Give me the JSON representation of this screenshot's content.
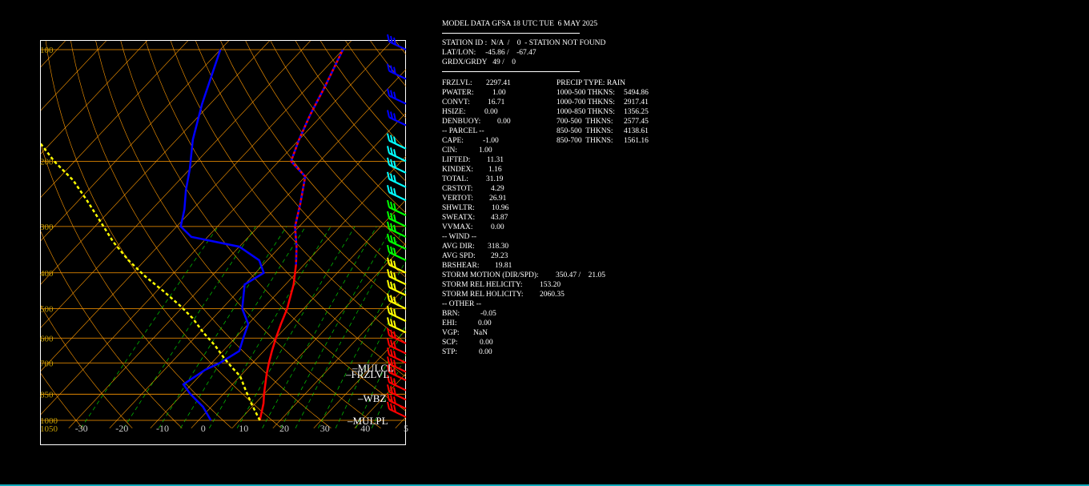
{
  "header": {
    "title": "MODEL DATA GFSA 18 UTC TUE  6 MAY 2025",
    "station": "STATION ID :  N/A  /    0  - STATION NOT FOUND",
    "latlon": "LAT/LON:     -45.86 /    -67.47",
    "grid": "GRDX/GRDY   49 /    0"
  },
  "left_stats": [
    {
      "k": "FRZLVL:",
      "v": "2297.41"
    },
    {
      "k": "PWATER:",
      "v": "1.00"
    },
    {
      "k": "CONVT:",
      "v": "16.71"
    },
    {
      "k": "HSIZE:",
      "v": "0.00"
    },
    {
      "k": "DENBUOY:",
      "v": "0.00"
    },
    {
      "k": "-- PARCEL --",
      "v": ""
    },
    {
      "k": "CAPE:",
      "v": "-1.00"
    },
    {
      "k": "CIN:",
      "v": "1.00"
    },
    {
      "k": "LIFTED:",
      "v": "11.31"
    },
    {
      "k": "KINDEX:",
      "v": "1.16"
    },
    {
      "k": "TOTAL:",
      "v": "31.19"
    },
    {
      "k": "CRSTOT:",
      "v": "4.29"
    },
    {
      "k": "VERTOT:",
      "v": "26.91"
    },
    {
      "k": "SHWLTR:",
      "v": "10.96"
    },
    {
      "k": "SWEATX:",
      "v": "43.87"
    },
    {
      "k": "VVMAX:",
      "v": "0.00"
    },
    {
      "k": "-- WIND --",
      "v": ""
    },
    {
      "k": "AVG DIR:",
      "v": "318.30"
    },
    {
      "k": "AVG SPD:",
      "v": "29.23"
    },
    {
      "k": "BRSHEAR:",
      "v": "19.81"
    },
    {
      "k": "STORM MOTION (DIR/SPD):",
      "v": "350.47 /    21.05"
    },
    {
      "k": "STORM REL HELICITY:",
      "v": "153.20"
    },
    {
      "k": "STORM REL HOLICITY:",
      "v": "2060.35"
    },
    {
      "k": "-- OTHER --",
      "v": ""
    },
    {
      "k": "BRN:",
      "v": "-0.05"
    },
    {
      "k": "EHI:",
      "v": "0.00"
    },
    {
      "k": "VGP:",
      "v": "NaN"
    },
    {
      "k": "SCP:",
      "v": "0.00"
    },
    {
      "k": "STP:",
      "v": "0.00"
    }
  ],
  "right_stats": [
    {
      "k": "PRECIP TYPE: RAIN",
      "v": ""
    },
    {
      "k": "1000-500 THKNS:",
      "v": "5494.86"
    },
    {
      "k": "1000-700 THKNS:",
      "v": "2917.41"
    },
    {
      "k": "1000-850 THKNS:",
      "v": "1356.25"
    },
    {
      "k": "700-500  THKNS:",
      "v": "2577.45"
    },
    {
      "k": "850-500  THKNS:",
      "v": "4138.61"
    },
    {
      "k": "850-700  THKNS:",
      "v": "1561.16"
    }
  ],
  "chart_data": {
    "type": "line",
    "xlabel": "",
    "ylabel": "",
    "x_ticks": [
      "-30",
      "-20",
      "-10",
      "0",
      "10",
      "20",
      "30",
      "40",
      "5"
    ],
    "x_tick_values": [
      -30,
      -20,
      -10,
      0,
      10,
      20,
      30,
      40,
      50
    ],
    "y_ticks": [
      "100",
      "200",
      "300",
      "400",
      "500",
      "600",
      "700",
      "850",
      "1000",
      "1050"
    ],
    "y_tick_values": [
      100,
      200,
      300,
      400,
      500,
      600,
      700,
      850,
      1000,
      1050
    ],
    "xlim": [
      -40,
      50
    ],
    "ylim": [
      1050,
      100
    ],
    "level_labels": [
      {
        "text": "MULCL",
        "p": 700
      },
      {
        "text": "FRZLVL",
        "p": 720
      },
      {
        "text": "WBZ",
        "p": 850
      },
      {
        "text": "MULPL",
        "p": 1000
      }
    ],
    "colors": {
      "temperature": "#ff0000",
      "dewpoint": "#0000ff",
      "parcel": "#ffff00",
      "isotherm": "#ff9900",
      "isobar": "#ff9900",
      "mixing_ratio": "#00cc00"
    },
    "series": [
      {
        "name": "Temperature",
        "color": "#ff0000",
        "points": [
          [
            15,
            1000
          ],
          [
            12,
            900
          ],
          [
            10,
            850
          ],
          [
            6,
            750
          ],
          [
            4,
            700
          ],
          [
            2,
            650
          ],
          [
            0,
            600
          ],
          [
            -2,
            550
          ],
          [
            -4,
            500
          ],
          [
            -8,
            430
          ],
          [
            -12,
            380
          ],
          [
            -16,
            340
          ],
          [
            -21,
            300
          ],
          [
            -25,
            260
          ],
          [
            -30,
            220
          ],
          [
            -37,
            200
          ],
          [
            -40,
            175
          ],
          [
            -43,
            150
          ],
          [
            -46,
            125
          ],
          [
            -50,
            100
          ]
        ]
      },
      {
        "name": "Dewpoint",
        "color": "#0000ff",
        "points": [
          [
            3,
            1000
          ],
          [
            -2,
            920
          ],
          [
            -8,
            850
          ],
          [
            -12,
            800
          ],
          [
            -10,
            730
          ],
          [
            -8,
            700
          ],
          [
            -6,
            650
          ],
          [
            -8,
            600
          ],
          [
            -10,
            550
          ],
          [
            -15,
            500
          ],
          [
            -20,
            430
          ],
          [
            -18,
            400
          ],
          [
            -22,
            370
          ],
          [
            -30,
            340
          ],
          [
            -44,
            320
          ],
          [
            -49,
            300
          ],
          [
            -52,
            270
          ],
          [
            -56,
            240
          ],
          [
            -60,
            210
          ],
          [
            -66,
            175
          ],
          [
            -72,
            140
          ],
          [
            -80,
            100
          ]
        ]
      },
      {
        "name": "Parcel",
        "color": "#ffff00",
        "points": [
          [
            15,
            1000
          ],
          [
            9,
            900
          ],
          [
            4,
            820
          ],
          [
            0,
            760
          ],
          [
            -4,
            720
          ],
          [
            -8,
            680
          ],
          [
            -13,
            630
          ],
          [
            -19,
            580
          ],
          [
            -25,
            530
          ],
          [
            -31,
            490
          ],
          [
            -38,
            450
          ],
          [
            -46,
            410
          ],
          [
            -54,
            370
          ],
          [
            -62,
            330
          ],
          [
            -70,
            290
          ],
          [
            -78,
            255
          ],
          [
            -86,
            225
          ],
          [
            -95,
            200
          ],
          [
            -104,
            175
          ],
          [
            -113,
            150
          ],
          [
            -122,
            128
          ],
          [
            -131,
            108
          ]
        ]
      }
    ],
    "wind_barbs": [
      {
        "p": 100,
        "color": "#0000ff"
      },
      {
        "p": 120,
        "color": "#0000ff"
      },
      {
        "p": 140,
        "color": "#0000ff"
      },
      {
        "p": 160,
        "color": "#0000ff"
      },
      {
        "p": 185,
        "color": "#00ffff"
      },
      {
        "p": 200,
        "color": "#00ffff"
      },
      {
        "p": 215,
        "color": "#00ffff"
      },
      {
        "p": 235,
        "color": "#00ffff"
      },
      {
        "p": 255,
        "color": "#00ffff"
      },
      {
        "p": 280,
        "color": "#00ff00"
      },
      {
        "p": 300,
        "color": "#00ff00"
      },
      {
        "p": 320,
        "color": "#00ff00"
      },
      {
        "p": 345,
        "color": "#00ff00"
      },
      {
        "p": 370,
        "color": "#00ff00"
      },
      {
        "p": 400,
        "color": "#ffff00"
      },
      {
        "p": 430,
        "color": "#ffff00"
      },
      {
        "p": 460,
        "color": "#ffff00"
      },
      {
        "p": 500,
        "color": "#ffff00"
      },
      {
        "p": 540,
        "color": "#ffff00"
      },
      {
        "p": 580,
        "color": "#ffff00"
      },
      {
        "p": 620,
        "color": "#ff0000"
      },
      {
        "p": 660,
        "color": "#ff0000"
      },
      {
        "p": 700,
        "color": "#ff0000"
      },
      {
        "p": 740,
        "color": "#ff0000"
      },
      {
        "p": 780,
        "color": "#ff0000"
      },
      {
        "p": 830,
        "color": "#ff0000"
      },
      {
        "p": 880,
        "color": "#ff0000"
      },
      {
        "p": 930,
        "color": "#ff0000"
      },
      {
        "p": 980,
        "color": "#ff0000"
      }
    ]
  }
}
